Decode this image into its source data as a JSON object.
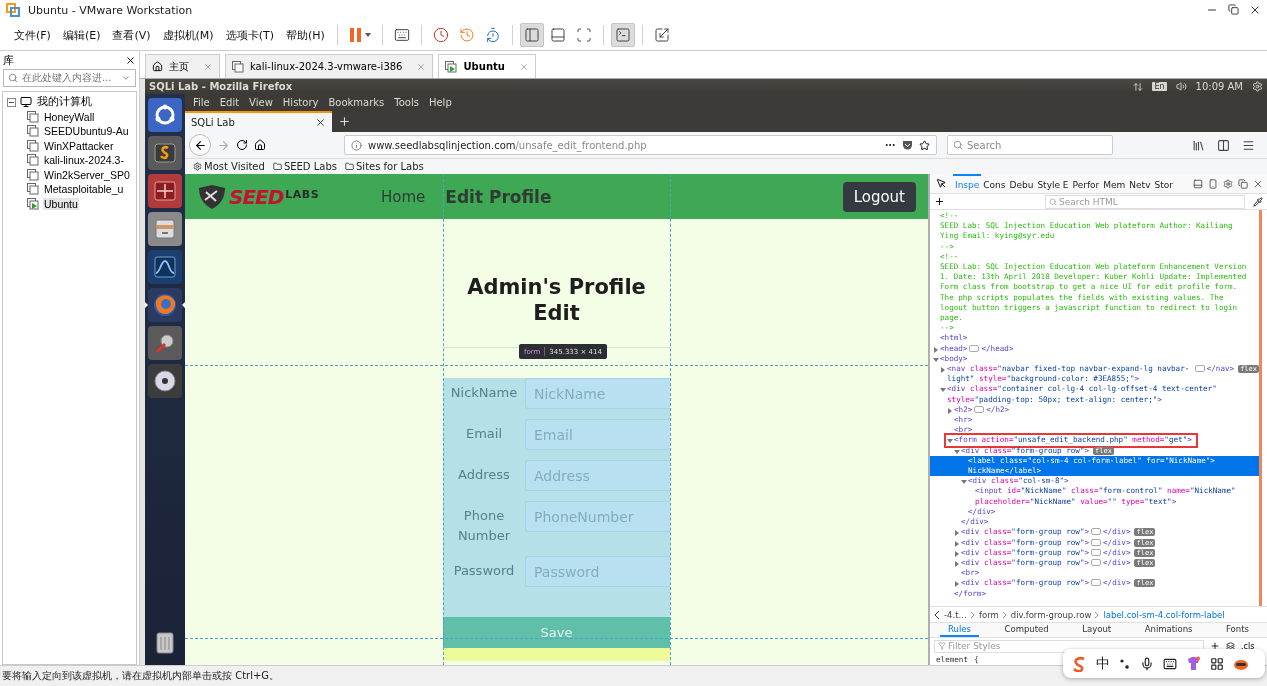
{
  "window": {
    "title": "Ubuntu - VMware Workstation"
  },
  "menu": [
    "文件(F)",
    "编辑(E)",
    "查看(V)",
    "虚拟机(M)",
    "选项卡(T)",
    "帮助(H)"
  ],
  "toolbar": [
    {
      "kind": "pause",
      "selected": false
    },
    {
      "kind": "send-keys",
      "selected": false
    },
    {
      "kind": "snapshot",
      "selected": false
    },
    {
      "kind": "revert",
      "selected": false
    },
    {
      "kind": "snapshot-manager",
      "selected": false
    },
    {
      "kind": "view-library",
      "selected": true
    },
    {
      "kind": "view-thumbnail",
      "selected": false
    },
    {
      "kind": "fullscreen",
      "selected": false
    },
    {
      "kind": "console",
      "selected": true
    },
    {
      "kind": "stretch",
      "selected": false
    }
  ],
  "library": {
    "title": "库",
    "search_placeholder": "在此处键入内容进...",
    "tree": {
      "label": "我的计算机",
      "expanded": true,
      "children": [
        {
          "label": "HoneyWall",
          "selected": false,
          "running": false
        },
        {
          "label": "SEEDUbuntu9-Au",
          "selected": false,
          "running": false
        },
        {
          "label": "WinXPattacker",
          "selected": false,
          "running": false
        },
        {
          "label": "kali-linux-2024.3-",
          "selected": false,
          "running": false
        },
        {
          "label": "Win2kServer_SP0",
          "selected": false,
          "running": false
        },
        {
          "label": "Metasploitable_u",
          "selected": false,
          "running": false
        },
        {
          "label": "Ubuntu",
          "selected": true,
          "running": true
        }
      ]
    }
  },
  "vm_tabs": [
    {
      "label": "主页",
      "kind": "home",
      "selected": false
    },
    {
      "label": "kali-linux-2024.3-vmware-i386",
      "kind": "vm",
      "selected": false
    },
    {
      "label": "Ubuntu",
      "kind": "vm-running",
      "selected": true
    }
  ],
  "ubuntu_bar": {
    "title": "SQLi Lab - Mozilla Firefox",
    "keyboard": "En",
    "time": "10:09 AM"
  },
  "launcher": [
    {
      "kind": "dash",
      "selected": false
    },
    {
      "kind": "editor",
      "selected": false
    },
    {
      "kind": "grid-app",
      "selected": false
    },
    {
      "kind": "drawer",
      "selected": false
    },
    {
      "kind": "wave-app",
      "selected": false
    },
    {
      "kind": "browser",
      "selected": true
    },
    {
      "kind": "settings",
      "selected": false
    },
    {
      "kind": "disc",
      "selected": false
    },
    {
      "kind": "trash",
      "selected": false
    }
  ],
  "firefox": {
    "menu": [
      "File",
      "Edit",
      "View",
      "History",
      "Bookmarks",
      "Tools",
      "Help"
    ],
    "tab": "SQLi Lab",
    "url": {
      "host": "www.seedlabsqlinjection.com",
      "path": "/unsafe_edit_frontend.php"
    },
    "search_placeholder": "Search",
    "bookmarks": [
      {
        "label": "Most Visited",
        "kind": "gear"
      },
      {
        "label": "SEED Labs",
        "kind": "folder"
      },
      {
        "label": "Sites for Labs",
        "kind": "folder"
      }
    ]
  },
  "page": {
    "logo": {
      "main": "SEED",
      "sub": "LABS"
    },
    "nav": [
      {
        "label": "Home",
        "selected": false
      },
      {
        "label": "Edit Profile",
        "selected": true
      }
    ],
    "logout": "Logout",
    "heading": "Admin's Profile Edit",
    "tooltip": {
      "tag": "form",
      "size": "345.333 × 414"
    },
    "fields": [
      {
        "label": "NickName",
        "placeholder": "NickName"
      },
      {
        "label": "Email",
        "placeholder": "Email"
      },
      {
        "label": "Address",
        "placeholder": "Address"
      },
      {
        "label": "Phone Number",
        "placeholder": "PhoneNumber"
      },
      {
        "label": "Password",
        "placeholder": "Password"
      }
    ],
    "save": "Save"
  },
  "devtools": {
    "tabs": [
      {
        "label": "Inspe",
        "selected": true
      },
      {
        "label": "Cons",
        "selected": false
      },
      {
        "label": "Debu",
        "selected": false
      },
      {
        "label": "Style E",
        "selected": false
      },
      {
        "label": "Perfor",
        "selected": false
      },
      {
        "label": "Mem",
        "selected": false
      },
      {
        "label": "Netv",
        "selected": false
      },
      {
        "label": "Stor",
        "selected": false
      }
    ],
    "search_placeholder": "Search HTML",
    "dom_tree": [
      {
        "kind": "comment",
        "open": "<!--",
        "text": "SEED Lab: SQL Injection Education Web plateform Author: Kailiang Ying Email: kying@syr.edu",
        "close": "-->"
      },
      {
        "kind": "comment",
        "open": "<!--",
        "text": "SEED Lab: SQL Injection Education Web plateform Enhancement Version 1. Date: 13th April 2018 Developer: Kuber Kohli Update: Implemented Form class from bootstrap to get a nice UI for edit profile form. The php scripts populates the fields with existing values. The logout button triggers a javascript function to redirect to login page.",
        "close": "-->"
      },
      {
        "kind": "element",
        "open": "<html>",
        "selected": false,
        "children": [
          {
            "kind": "element",
            "open": "<head>",
            "close": "</head>",
            "expanded": false,
            "selected": false
          },
          {
            "kind": "element",
            "open": "<body>",
            "expanded": true,
            "selected": false,
            "children": [
              {
                "kind": "element",
                "open": "<nav class=\"navbar fixed-top navbar-expand-lg navbar-light\" style=\"background-color: #3EA855;\">",
                "close": "</nav>",
                "expanded": false,
                "selected": false,
                "badge": "flex"
              },
              {
                "kind": "element",
                "open": "<div class=\"container col-lg-4 col-lg-offset-4 text-center\" style=\"padding-top: 50px; text-align: center;\">",
                "expanded": true,
                "selected": false,
                "children": [
                  {
                    "kind": "element",
                    "open": "<h2>",
                    "close": "</h2>",
                    "expanded": false,
                    "selected": false
                  },
                  {
                    "kind": "element",
                    "open": "<hr>",
                    "selected": false
                  },
                  {
                    "kind": "element",
                    "open": "<br>",
                    "selected": false
                  },
                  {
                    "kind": "element",
                    "open": "<form action=\"unsafe_edit_backend.php\" method=\"get\">",
                    "close": "</form>",
                    "expanded": true,
                    "selected": false,
                    "annotated": true,
                    "children": [
                      {
                        "kind": "element",
                        "open": "<div class=\"form-group row\">",
                        "close": "</div>",
                        "expanded": true,
                        "selected": false,
                        "badge": "flex",
                        "children": [
                          {
                            "kind": "element",
                            "open": "<label class=\"col-sm-4 col-form-label\" for=\"NickName\">",
                            "text": "NickName",
                            "close": "</label>",
                            "selected": true
                          },
                          {
                            "kind": "element",
                            "open": "<div class=\"col-sm-8\">",
                            "close": "</div>",
                            "expanded": true,
                            "selected": false,
                            "children": [
                              {
                                "kind": "element",
                                "open": "<input id=\"NickName\" class=\"form-control\" name=\"NickName\" placeholder=\"NickName\" value=\"\" type=\"text\">",
                                "selected": false
                              }
                            ]
                          }
                        ]
                      },
                      {
                        "kind": "element",
                        "open": "<div class=\"form-group row\">",
                        "close": "</div>",
                        "expanded": false,
                        "selected": false,
                        "badge": "flex"
                      },
                      {
                        "kind": "element",
                        "open": "<div class=\"form-group row\">",
                        "close": "</div>",
                        "expanded": false,
                        "selected": false,
                        "badge": "flex"
                      },
                      {
                        "kind": "element",
                        "open": "<div class=\"form-group row\">",
                        "close": "</div>",
                        "expanded": false,
                        "selected": false,
                        "badge": "flex"
                      },
                      {
                        "kind": "element",
                        "open": "<div class=\"form-group row\">",
                        "close": "</div>",
                        "expanded": false,
                        "selected": false,
                        "badge": "flex"
                      },
                      {
                        "kind": "element",
                        "open": "<br>",
                        "selected": false
                      },
                      {
                        "kind": "element",
                        "open": "<div class=\"form-group row\">",
                        "close": "</div>",
                        "expanded": false,
                        "selected": false,
                        "badge": "flex"
                      }
                    ]
                  }
                ]
              }
            ]
          }
        ]
      }
    ],
    "breadcrumbs": [
      {
        "label": "-4.t…",
        "selected": false
      },
      {
        "label": "form",
        "selected": false
      },
      {
        "label": "div.form-group.row",
        "selected": false
      },
      {
        "label": "label.col-sm-4.col-form-label",
        "selected": true
      }
    ],
    "side_tabs": [
      {
        "label": "Rules",
        "selected": true
      },
      {
        "label": "Computed",
        "selected": false
      },
      {
        "label": "Layout",
        "selected": false
      },
      {
        "label": "Animations",
        "selected": false
      },
      {
        "label": "Fonts",
        "selected": false
      }
    ],
    "filter_placeholder": "Filter Styles",
    "cls": ".cls",
    "rule": {
      "selector": "element",
      "brace": "{"
    }
  },
  "ime": {
    "mode": "中"
  },
  "status": "要将输入定向到该虚拟机，请在虚拟机内部单击或按 Ctrl+G。"
}
